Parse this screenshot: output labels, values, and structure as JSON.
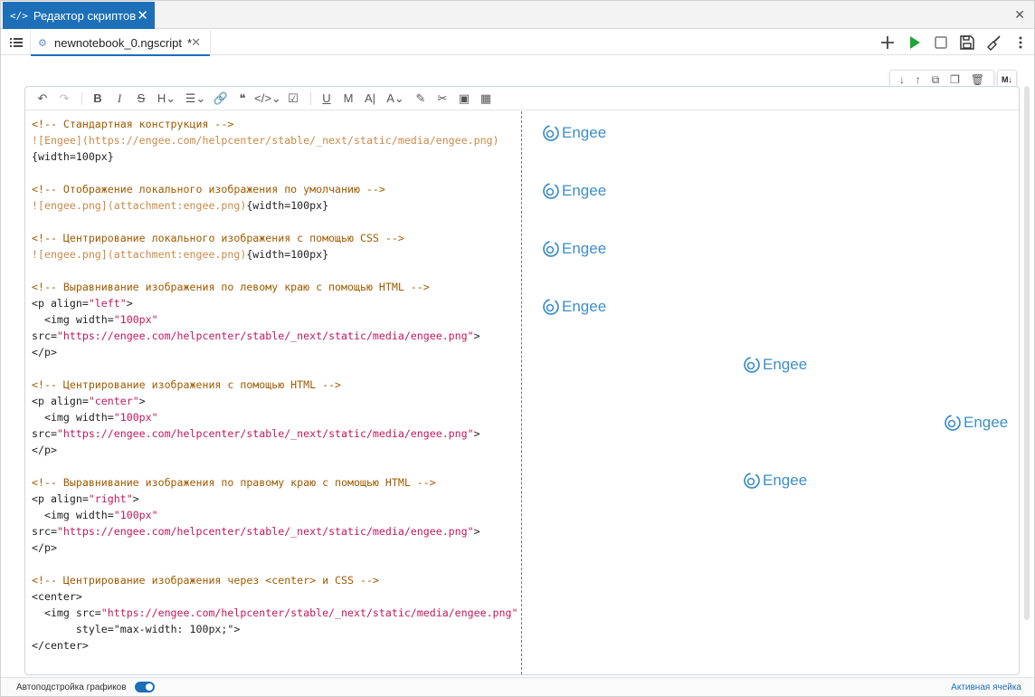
{
  "window_tab": {
    "title": "Редактор скриптов"
  },
  "file_tab": {
    "name": "newnotebook_0.ngscript",
    "modified_marker": "*"
  },
  "actions": [
    "add-icon",
    "run-icon",
    "stop-icon",
    "save-icon",
    "clear-icon",
    "more-icon"
  ],
  "cell_tools": [
    "move-down-icon",
    "move-up-icon",
    "copy-icon",
    "duplicate-icon",
    "delete-icon"
  ],
  "md_toggle_label": "M↓",
  "editor_lines": [
    [
      {
        "c": "cm",
        "t": "<!-- Стандартная конструкция -->"
      }
    ],
    [
      {
        "c": "lk",
        "t": "![Engee](https://engee.com/helpcenter/stable/_next/static/media/engee.png)"
      }
    ],
    [
      {
        "c": "",
        "t": "{width=100px}"
      }
    ],
    [],
    [
      {
        "c": "cm",
        "t": "<!-- Отображение локального изображения по умолчанию -->"
      }
    ],
    [
      {
        "c": "lk",
        "t": "![engee.png](attachment:engee.png)"
      },
      {
        "c": "",
        "t": "{width=100px}"
      }
    ],
    [],
    [
      {
        "c": "cm",
        "t": "<!-- Центрирование локального изображения с помощью CSS -->"
      }
    ],
    [
      {
        "c": "lk",
        "t": "![engee.png](attachment:engee.png)"
      },
      {
        "c": "",
        "t": "{width=100px}"
      }
    ],
    [],
    [
      {
        "c": "cm",
        "t": "<!-- Выравнивание изображения по левому краю с помощью HTML -->"
      }
    ],
    [
      {
        "c": "",
        "t": "<p align="
      },
      {
        "c": "st",
        "t": "\"left\""
      },
      {
        "c": "",
        "t": ">"
      }
    ],
    [
      {
        "c": "",
        "t": "  <img width="
      },
      {
        "c": "st",
        "t": "\"100px\""
      }
    ],
    [
      {
        "c": "",
        "t": "src="
      },
      {
        "c": "st",
        "t": "\"https://engee.com/helpcenter/stable/_next/static/media/engee.png\""
      },
      {
        "c": "",
        "t": ">"
      }
    ],
    [
      {
        "c": "",
        "t": "</p>"
      }
    ],
    [],
    [
      {
        "c": "cm",
        "t": "<!-- Центрирование изображения с помощью HTML -->"
      }
    ],
    [
      {
        "c": "",
        "t": "<p align="
      },
      {
        "c": "st",
        "t": "\"center\""
      },
      {
        "c": "",
        "t": ">"
      }
    ],
    [
      {
        "c": "",
        "t": "  <img width="
      },
      {
        "c": "st",
        "t": "\"100px\""
      }
    ],
    [
      {
        "c": "",
        "t": "src="
      },
      {
        "c": "st",
        "t": "\"https://engee.com/helpcenter/stable/_next/static/media/engee.png\""
      },
      {
        "c": "",
        "t": ">"
      }
    ],
    [
      {
        "c": "",
        "t": "</p>"
      }
    ],
    [],
    [
      {
        "c": "cm",
        "t": "<!-- Выравнивание изображения по правому краю с помощью HTML -->"
      }
    ],
    [
      {
        "c": "",
        "t": "<p align="
      },
      {
        "c": "st",
        "t": "\"right\""
      },
      {
        "c": "",
        "t": ">"
      }
    ],
    [
      {
        "c": "",
        "t": "  <img width="
      },
      {
        "c": "st",
        "t": "\"100px\""
      }
    ],
    [
      {
        "c": "",
        "t": "src="
      },
      {
        "c": "st",
        "t": "\"https://engee.com/helpcenter/stable/_next/static/media/engee.png\""
      },
      {
        "c": "",
        "t": ">"
      }
    ],
    [
      {
        "c": "",
        "t": "</p>"
      }
    ],
    [],
    [
      {
        "c": "cm",
        "t": "<!-- Центрирование изображения через <center> и CSS -->"
      }
    ],
    [
      {
        "c": "",
        "t": "<center>"
      }
    ],
    [
      {
        "c": "",
        "t": "  <img src="
      },
      {
        "c": "st",
        "t": "\"https://engee.com/helpcenter/stable/_next/static/media/engee.png\""
      }
    ],
    [
      {
        "c": "",
        "t": "       style="
      },
      {
        "c": "",
        "t": "\"max-width: 100px;\""
      },
      {
        "c": "",
        "t": ">"
      }
    ],
    [
      {
        "c": "",
        "t": "</center>"
      }
    ]
  ],
  "preview_logos": [
    {
      "text": "Engee",
      "align": "left"
    },
    {
      "text": "Engee",
      "align": "left"
    },
    {
      "text": "Engee",
      "align": "left"
    },
    {
      "text": "Engee",
      "align": "left"
    },
    {
      "text": "Engee",
      "align": "center"
    },
    {
      "text": "Engee",
      "align": "right"
    },
    {
      "text": "Engee",
      "align": "center"
    }
  ],
  "status": {
    "autosize_label": "Автоподстройка графиков",
    "active_cell": "Активная ячейка"
  },
  "colors": {
    "accent": "#1d6fb8",
    "comment": "#a05a00",
    "link": "#c98a4a",
    "string": "#c2185b",
    "logo": "#3d8fc6",
    "run": "#22a33a"
  }
}
